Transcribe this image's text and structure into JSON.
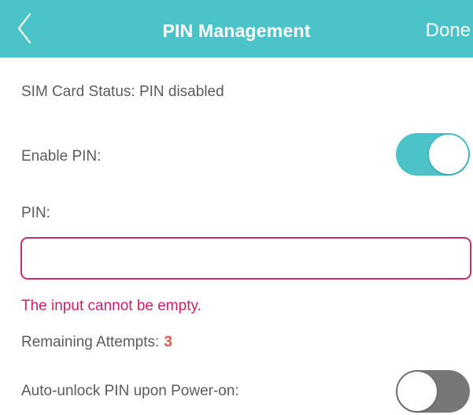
{
  "header": {
    "title": "PIN Management",
    "done_label": "Done",
    "background_color": "#4cc3c9"
  },
  "sim_status": {
    "text": "SIM Card Status: PIN disabled"
  },
  "enable_pin": {
    "label": "Enable PIN:",
    "state": "on"
  },
  "pin": {
    "label": "PIN:",
    "value": "",
    "error": "The input cannot be empty."
  },
  "remaining": {
    "label": "Remaining Attempts:",
    "value": "3"
  },
  "auto_unlock": {
    "label": "Auto-unlock PIN upon Power-on:",
    "state": "off"
  },
  "colors": {
    "accent": "#4cc3c9",
    "error": "#cc1f6a",
    "remaining_value": "#e8554a",
    "toggle_off": "#777777"
  }
}
